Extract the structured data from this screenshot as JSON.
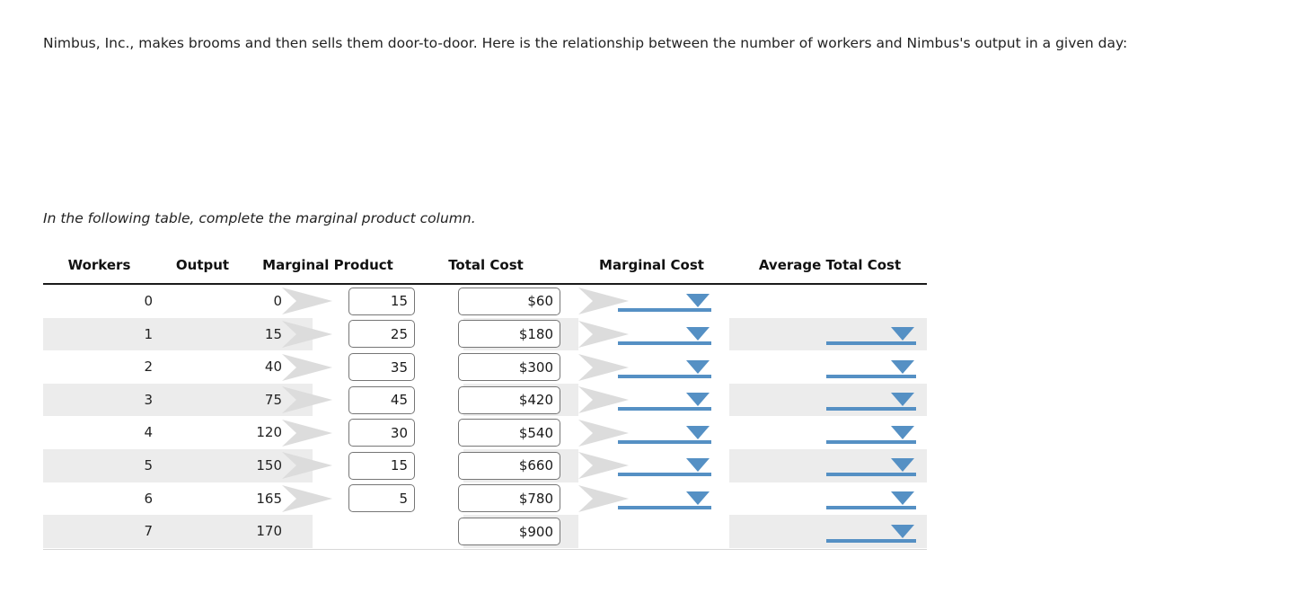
{
  "intro": {
    "paragraph": "Nimbus, Inc., makes brooms and then sells them door-to-door. Here is the relationship between the number of workers and Nimbus's output in a given day:",
    "instruction": "In the following table, complete the marginal product column."
  },
  "colors": {
    "accent_blue": "#5590c4",
    "arrow_gray": "#dcdcdc",
    "row_stripe": "#ececec",
    "header_rule": "#1a1a1a"
  },
  "table": {
    "headers": [
      "Workers",
      "Output",
      "Marginal Product",
      "Total Cost",
      "Marginal Cost",
      "Average Total Cost"
    ],
    "rows": [
      {
        "workers": "0",
        "output": "0",
        "total_cost": "$60"
      },
      {
        "workers": "1",
        "output": "15",
        "total_cost": "$180"
      },
      {
        "workers": "2",
        "output": "40",
        "total_cost": "$300"
      },
      {
        "workers": "3",
        "output": "75",
        "total_cost": "$420"
      },
      {
        "workers": "4",
        "output": "120",
        "total_cost": "$540"
      },
      {
        "workers": "5",
        "output": "150",
        "total_cost": "$660"
      },
      {
        "workers": "6",
        "output": "165",
        "total_cost": "$780"
      },
      {
        "workers": "7",
        "output": "170",
        "total_cost": "$900"
      }
    ],
    "marginal_product": [
      "15",
      "25",
      "35",
      "45",
      "30",
      "15",
      "5"
    ],
    "marginal_cost": [
      "",
      "",
      "",
      "",
      "",
      "",
      ""
    ],
    "average_total_cost": [
      "",
      "",
      "",
      "",
      "",
      "",
      ""
    ],
    "input_placeholder": ""
  }
}
